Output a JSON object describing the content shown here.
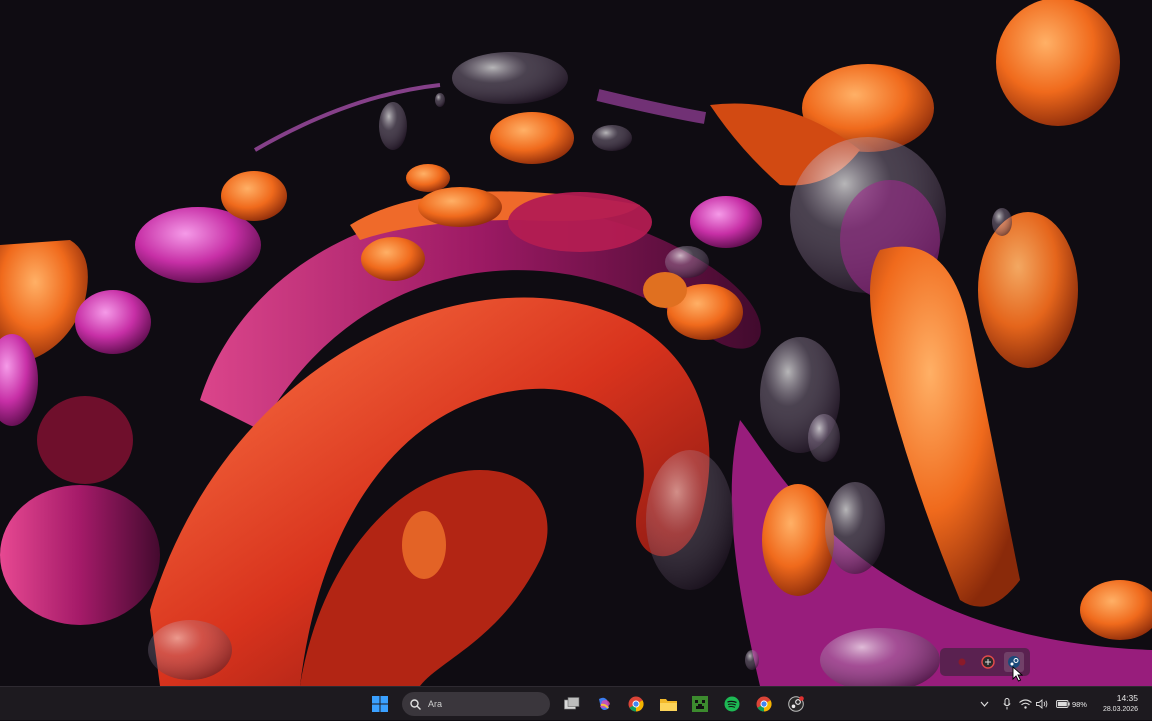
{
  "desktop": {
    "wallpaper": "Windows 11 Bloom abstract wallpaper",
    "colors": {
      "background": "#0f0c12",
      "orange": "#f06a1c",
      "magenta": "#c72fa6",
      "red": "#d8331d"
    }
  },
  "taskbar": {
    "background": "#1d1a1f",
    "search": {
      "placeholder": "Ara"
    },
    "pinned": [
      {
        "name": "start-button",
        "icon": "windows-logo-icon"
      },
      {
        "name": "task-view-button",
        "icon": "task-view-icon"
      },
      {
        "name": "copilot-button",
        "icon": "copilot-icon"
      },
      {
        "name": "chrome-button",
        "icon": "chrome-icon"
      },
      {
        "name": "file-explorer-button",
        "icon": "folder-icon"
      },
      {
        "name": "minecraft-button",
        "icon": "minecraft-icon"
      },
      {
        "name": "spotify-button",
        "icon": "spotify-icon"
      },
      {
        "name": "chrome-profile-button",
        "icon": "chrome-icon"
      },
      {
        "name": "steam-button",
        "icon": "steam-icon"
      }
    ],
    "tray": {
      "battery_percent": "98%",
      "time": "14:35",
      "date": "28.03.2026"
    }
  },
  "overflow_flyout": {
    "icons": [
      "red-dot-icon",
      "app-icon",
      "steam-icon"
    ]
  }
}
